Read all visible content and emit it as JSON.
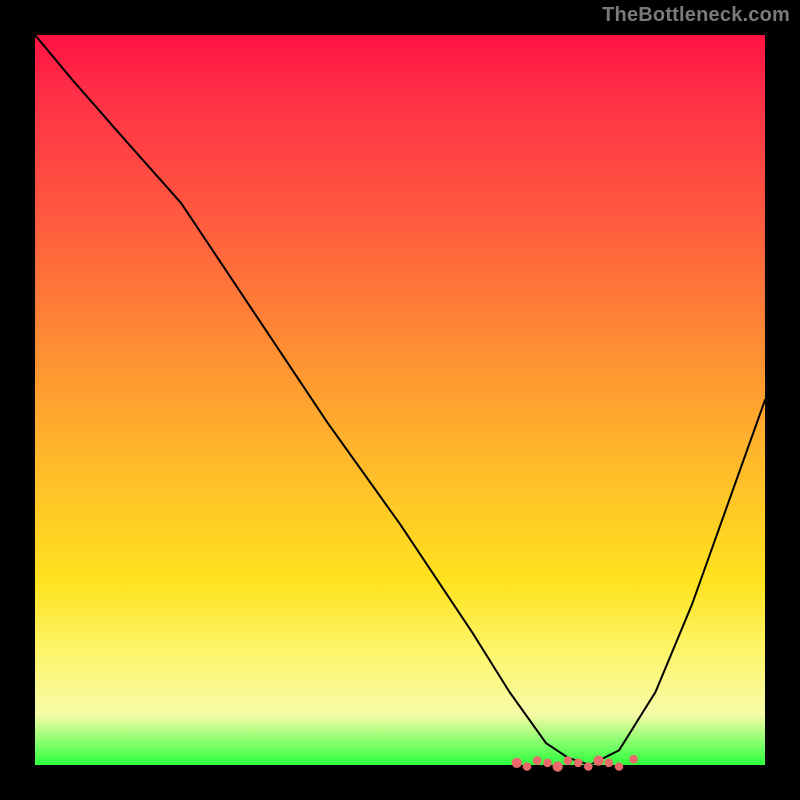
{
  "credit": "TheBottleneck.com",
  "chart_data": {
    "type": "line",
    "title": "",
    "xlabel": "",
    "ylabel": "",
    "xlim": [
      0,
      100
    ],
    "ylim": [
      0,
      100
    ],
    "x": [
      0,
      5,
      12,
      20,
      30,
      40,
      50,
      60,
      65,
      70,
      73,
      76,
      80,
      85,
      90,
      95,
      100
    ],
    "values": [
      100,
      94,
      86,
      77,
      62,
      47,
      33,
      18,
      10,
      3,
      1,
      0,
      2,
      10,
      22,
      36,
      50
    ],
    "annotations": [
      {
        "type": "dot-cluster",
        "x_range": [
          66,
          80
        ],
        "y": 0
      }
    ]
  },
  "colors": {
    "background": "#000000",
    "gradient_top": "#ff1243",
    "gradient_mid": "#ffb82b",
    "gradient_bottom": "#2bff3d",
    "curve": "#000000",
    "dots": "#e96a6a",
    "credit_text": "#7a7a7a"
  }
}
